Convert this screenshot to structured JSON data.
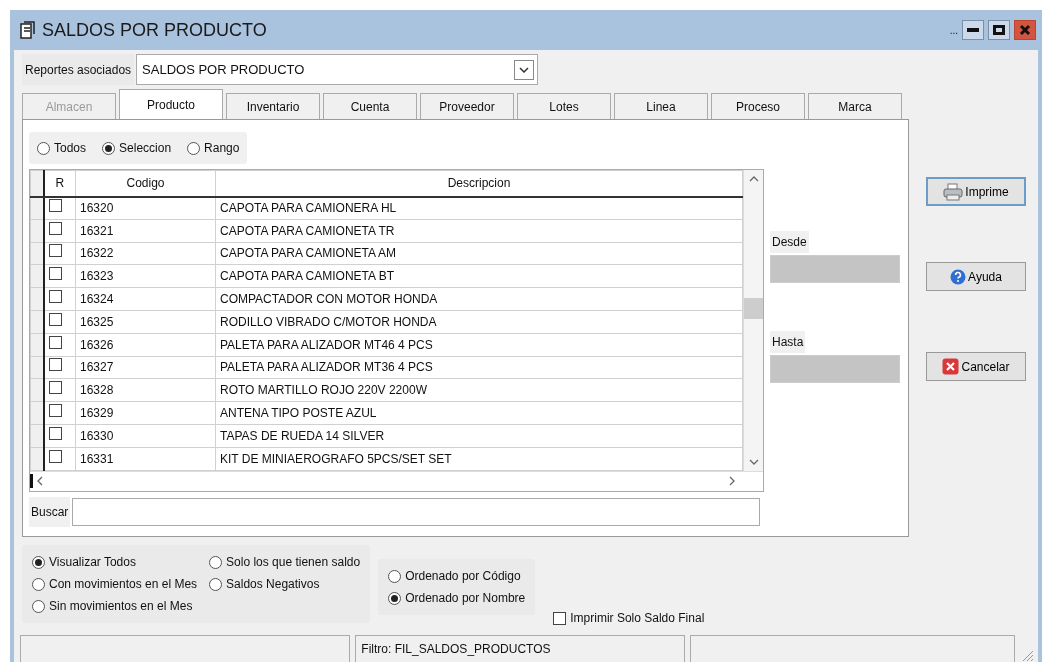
{
  "window": {
    "title": "SALDOS POR PRODUCTO",
    "overflow": "..."
  },
  "report": {
    "label": "Reportes asociados",
    "value": "SALDOS POR PRODUCTO"
  },
  "tabs": [
    {
      "label": "Almacen",
      "selected": false,
      "disabled": true
    },
    {
      "label": "Producto",
      "selected": true,
      "disabled": false
    },
    {
      "label": "Inventario",
      "selected": false,
      "disabled": false
    },
    {
      "label": "Cuenta",
      "selected": false,
      "disabled": false
    },
    {
      "label": "Proveedor",
      "selected": false,
      "disabled": false
    },
    {
      "label": "Lotes",
      "selected": false,
      "disabled": false
    },
    {
      "label": "Linea",
      "selected": false,
      "disabled": false
    },
    {
      "label": "Proceso",
      "selected": false,
      "disabled": false
    },
    {
      "label": "Marca",
      "selected": false,
      "disabled": false
    }
  ],
  "selection_mode": [
    {
      "label": "Todos",
      "selected": false
    },
    {
      "label": "Seleccion",
      "selected": true
    },
    {
      "label": "Rango",
      "selected": false
    }
  ],
  "grid": {
    "columns": [
      "R",
      "Codigo",
      "Descripcion"
    ],
    "rows": [
      {
        "checked": false,
        "codigo": "16320",
        "descripcion": "CAPOTA PARA CAMIONERA HL"
      },
      {
        "checked": false,
        "codigo": "16321",
        "descripcion": "CAPOTA PARA CAMIONETA TR"
      },
      {
        "checked": false,
        "codigo": "16322",
        "descripcion": "CAPOTA PARA CAMIONETA AM"
      },
      {
        "checked": false,
        "codigo": "16323",
        "descripcion": "CAPOTA PARA CAMIONETA BT"
      },
      {
        "checked": false,
        "codigo": "16324",
        "descripcion": "COMPACTADOR CON MOTOR HONDA"
      },
      {
        "checked": false,
        "codigo": "16325",
        "descripcion": "RODILLO VIBRADO C/MOTOR HONDA"
      },
      {
        "checked": false,
        "codigo": "16326",
        "descripcion": "PALETA PARA ALIZADOR MT46 4 PCS"
      },
      {
        "checked": false,
        "codigo": "16327",
        "descripcion": "PALETA PARA ALIZADOR MT36 4 PCS"
      },
      {
        "checked": false,
        "codigo": "16328",
        "descripcion": "ROTO MARTILLO ROJO 220V 2200W"
      },
      {
        "checked": false,
        "codigo": "16329",
        "descripcion": "ANTENA TIPO POSTE AZUL"
      },
      {
        "checked": false,
        "codigo": "16330",
        "descripcion": "TAPAS DE RUEDA 14 SILVER"
      },
      {
        "checked": false,
        "codigo": "16331",
        "descripcion": "KIT DE MINIAEROGRAFO 5PCS/SET SET"
      }
    ]
  },
  "range": {
    "from_label": "Desde",
    "to_label": "Hasta",
    "disabled": true
  },
  "search": {
    "label": "Buscar"
  },
  "buttons": [
    {
      "label": "Imprime",
      "kind": "print",
      "default": true
    },
    {
      "label": "Ayuda",
      "kind": "help",
      "default": false
    },
    {
      "label": "Cancelar",
      "kind": "cancel",
      "default": false
    }
  ],
  "filters": [
    {
      "label": "Visualizar Todos",
      "selected": true
    },
    {
      "label": "Con movimientos en el Mes",
      "selected": false
    },
    {
      "label": "Sin movimientos en el Mes",
      "selected": false
    },
    {
      "label": "Solo los que tienen saldo",
      "selected": false
    },
    {
      "label": "Saldos Negativos",
      "selected": false
    }
  ],
  "sort": [
    {
      "label": "Ordenado por Código",
      "selected": false
    },
    {
      "label": "Ordenado por Nombre",
      "selected": true
    }
  ],
  "print_final_only": {
    "label": "Imprimir Solo Saldo Final",
    "checked": false
  },
  "status_bar": {
    "filter": "Filtro: FIL_SALDOS_PRODUCTOS"
  }
}
